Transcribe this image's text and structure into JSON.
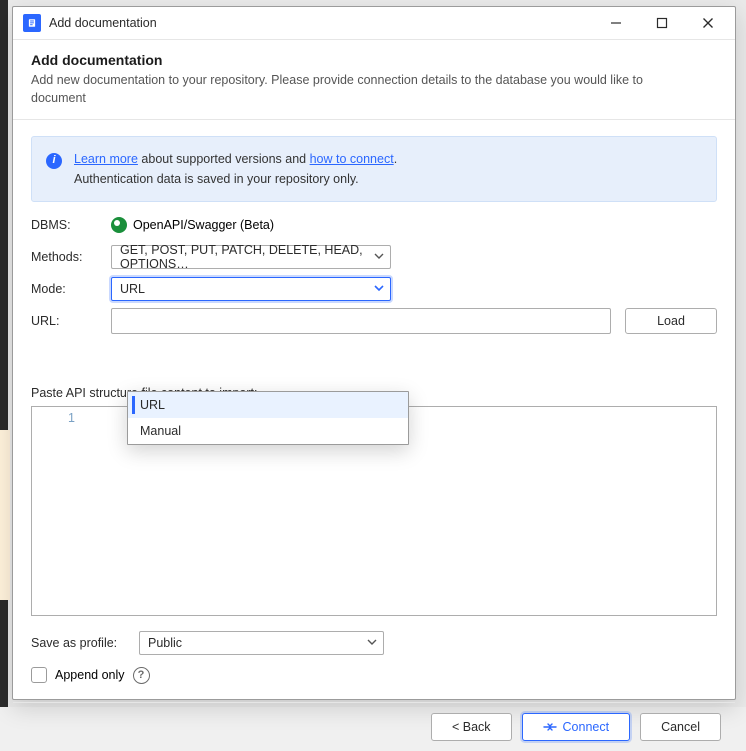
{
  "window": {
    "title": "Add documentation"
  },
  "header": {
    "title": "Add documentation",
    "subtitle": "Add new documentation to your repository. Please provide connection details to the database you would like to document"
  },
  "banner": {
    "learn_more": "Learn more",
    "mid1": " about supported versions and ",
    "how_to_connect": "how to connect",
    "mid2": ".",
    "line2": "Authentication data is saved in your repository only."
  },
  "labels": {
    "dbms": "DBMS:",
    "methods": "Methods:",
    "mode": "Mode:",
    "url": "URL:",
    "paste": "Paste API structure file content to import:",
    "save_as_profile": "Save as profile:",
    "append_only": "Append only"
  },
  "values": {
    "dbms": "OpenAPI/Swagger (Beta)",
    "methods": "GET, POST, PUT, PATCH, DELETE, HEAD, OPTIONS…",
    "mode": "URL",
    "profile": "Public",
    "line_number": "1"
  },
  "mode_options": [
    "URL",
    "Manual"
  ],
  "mode_selected_index": 0,
  "buttons": {
    "load": "Load",
    "back": "< Back",
    "connect": "Connect",
    "cancel": "Cancel"
  }
}
